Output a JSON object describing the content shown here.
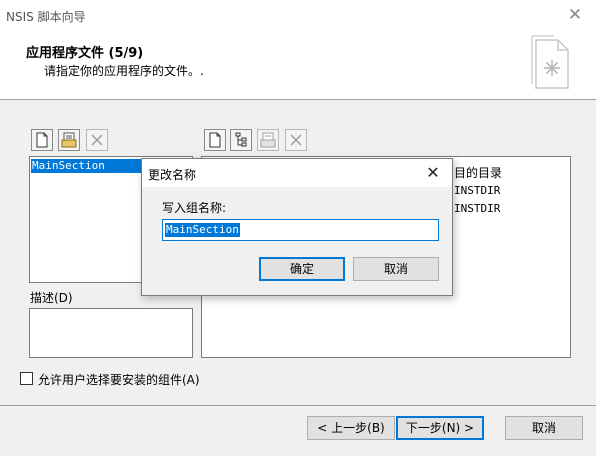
{
  "window": {
    "title": "NSIS 脚本向导",
    "header_title": "应用程序文件 (5/9)",
    "header_subtitle": "请指定你的应用程序的文件。."
  },
  "left_panel": {
    "sections": [
      "MainSection"
    ],
    "description_label": "描述(D)"
  },
  "right_panel": {
    "column_header": "目的目录",
    "rows": [
      "INSTDIR",
      "INSTDIR"
    ]
  },
  "options": {
    "allow_select_components": "允许用户选择要安装的组件(A)"
  },
  "footer": {
    "back_label": "< 上一步(B)",
    "next_label": "下一步(N) >",
    "cancel_label": "取消"
  },
  "dialog": {
    "title": "更改名称",
    "prompt": "写入组名称:",
    "value": "MainSection",
    "ok_label": "确定",
    "cancel_label": "取消"
  },
  "icons": {
    "titlebar_close": "close-icon",
    "header": "document-gear-icon",
    "toolbar_left": [
      "new-icon",
      "add-directory-icon",
      "delete-icon"
    ],
    "toolbar_right": [
      "new-icon",
      "tree-icon",
      "add-files-icon",
      "delete-icon"
    ]
  },
  "colors": {
    "selection": "#0078d7",
    "window_bg": "#f0f0f0",
    "header_bg": "#ffffff"
  }
}
